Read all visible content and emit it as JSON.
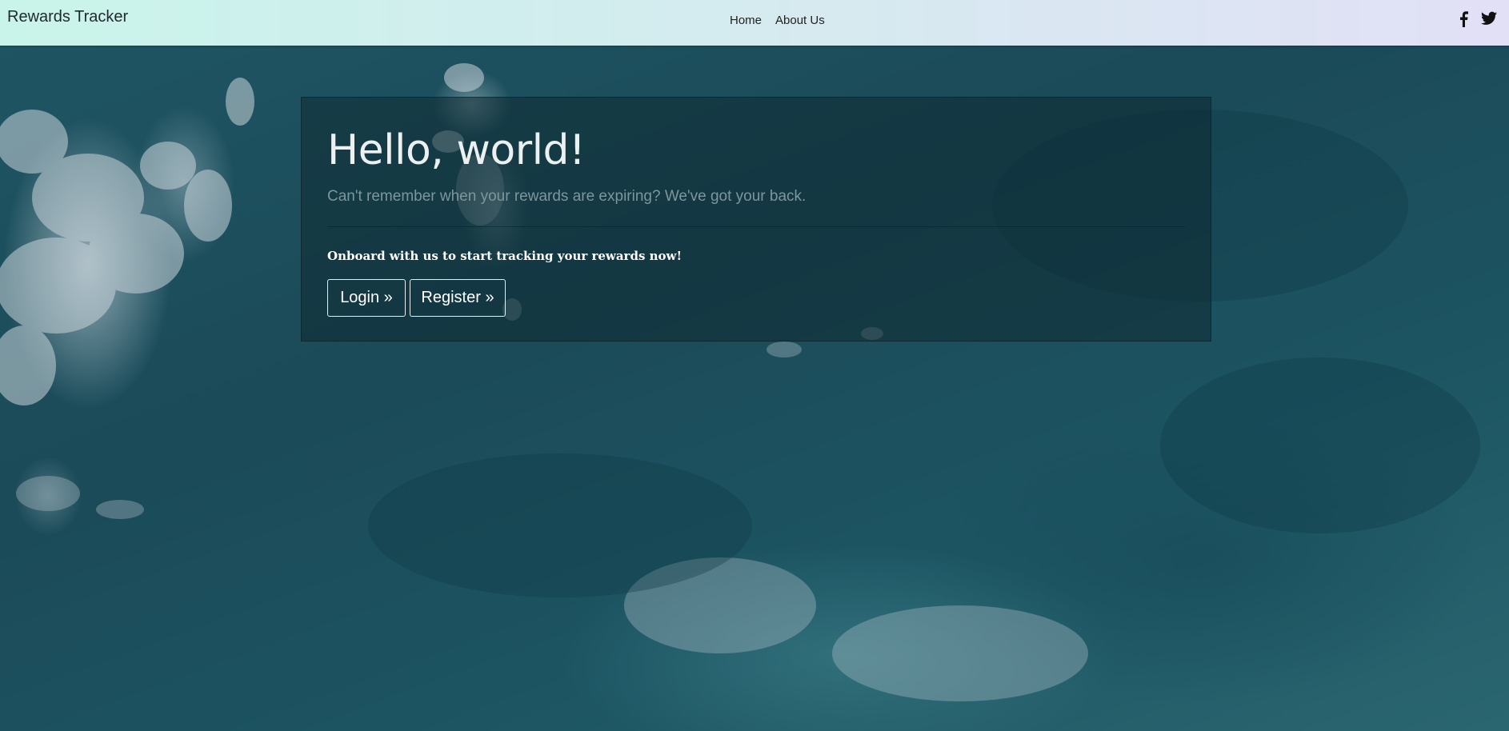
{
  "navbar": {
    "brand": "Rewards Tracker",
    "links": [
      "Home",
      "About Us"
    ],
    "social": [
      {
        "icon": "facebook-icon"
      },
      {
        "icon": "twitter-icon"
      }
    ]
  },
  "hero": {
    "heading": "Hello, world!",
    "lead": "Can't remember when your rewards are expiring? We've got your back.",
    "cta_text": "Onboard with us to start tracking your rewards now!",
    "login_label": "Login »",
    "register_label": "Register »"
  },
  "colors": {
    "navbar_start": "#c9f4ea",
    "navbar_end": "#e2e0f6",
    "ocean": "#1c4f5c"
  }
}
